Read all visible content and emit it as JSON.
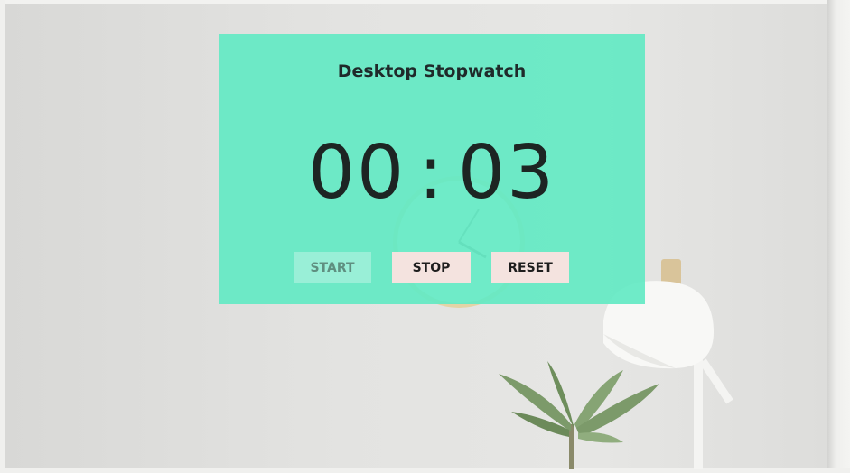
{
  "app": {
    "title": "Desktop Stopwatch"
  },
  "timer": {
    "minutes": "00",
    "separator": ":",
    "seconds": "03"
  },
  "controls": {
    "start_label": "START",
    "stop_label": "STOP",
    "reset_label": "RESET"
  },
  "colors": {
    "card": "#64EAC4",
    "button_active": "#F4E3DF",
    "text_dark": "#1D2523"
  }
}
